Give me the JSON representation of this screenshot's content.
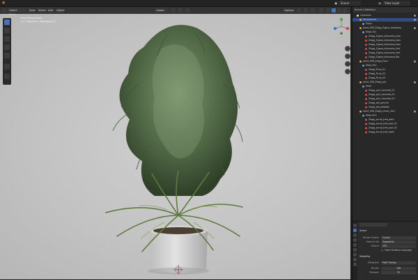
{
  "topbar": {
    "menu_icon": "blender-logo",
    "scene_label": "Scene",
    "view_layer_label": "View Layer",
    "options_label": "Options"
  },
  "viewport": {
    "mode_label": "Object Mode",
    "menus": [
      "View",
      "Select",
      "Add",
      "Object"
    ],
    "orientation_label": "Global",
    "overlay_lines": [
      "User Perspective",
      "(1) Collection | Background",
      "",
      ""
    ],
    "tools": [
      "cursor-tool",
      "move-tool",
      "rotate-tool",
      "scale-tool",
      "transform-tool",
      "annotate-tool",
      "measure-tool"
    ]
  },
  "outliner": {
    "title": "Scene Collection",
    "rows": [
      {
        "label": "Collection",
        "indent": 1,
        "type": "collection"
      },
      {
        "label": "Background",
        "indent": 2,
        "type": "object",
        "selected": true
      },
      {
        "label": "Plane",
        "indent": 3,
        "type": "mesh"
      },
      {
        "label": "plant_096_Ziagg_Zigaro_Ixilosomo",
        "indent": 2,
        "type": "object"
      },
      {
        "label": "Mesh.001",
        "indent": 3,
        "type": "mesh"
      },
      {
        "label": "Ziagg_Zigaro_Ixilosomo_leav",
        "indent": 4,
        "type": "material"
      },
      {
        "label": "Ziagg_Zigaro_Ixilosomo_leav",
        "indent": 4,
        "type": "material"
      },
      {
        "label": "Ziagg_Zigaro_Ixilosomo_leav",
        "indent": 4,
        "type": "material"
      },
      {
        "label": "Ziagg_Zigaro_Ixilosomo_leaf",
        "indent": 4,
        "type": "material"
      },
      {
        "label": "Ziagg_Zigaro_Ixilosomo_leaf",
        "indent": 4,
        "type": "material"
      },
      {
        "label": "Ziagg_Zigaro_Ixilosomo_Blo",
        "indent": 4,
        "type": "material"
      },
      {
        "label": "plant_096_Ziagg_Ficus",
        "indent": 2,
        "type": "object"
      },
      {
        "label": "Mesh.002",
        "indent": 3,
        "type": "mesh"
      },
      {
        "label": "Ziagg_Ficus_01",
        "indent": 4,
        "type": "material"
      },
      {
        "label": "Ziagg_Ficus_02",
        "indent": 4,
        "type": "material"
      },
      {
        "label": "Ziagg_Ficus_03",
        "indent": 4,
        "type": "material"
      },
      {
        "label": "plant_096_Ziagg_pot",
        "indent": 2,
        "type": "object"
      },
      {
        "label": "Mesh",
        "indent": 3,
        "type": "mesh"
      },
      {
        "label": "Ziagg_pot_Concrete_01",
        "indent": 4,
        "type": "material"
      },
      {
        "label": "Ziagg_pot_Concrete_02",
        "indent": 4,
        "type": "material"
      },
      {
        "label": "Ziagg_pot_Concrete_03",
        "indent": 4,
        "type": "material"
      },
      {
        "label": "Ziagg_pot_ground",
        "indent": 4,
        "type": "material"
      },
      {
        "label": "Ziagg_pot_pebbles",
        "indent": 4,
        "type": "material"
      },
      {
        "label": "plant_096_Ziagg_shrub_mini",
        "indent": 2,
        "type": "object"
      },
      {
        "label": "Mesh.003",
        "indent": 3,
        "type": "mesh"
      },
      {
        "label": "Ziagg_shrub_tree_bark",
        "indent": 4,
        "type": "material"
      },
      {
        "label": "Ziagg_shrub_tree_leaf_01",
        "indent": 4,
        "type": "material"
      },
      {
        "label": "Ziagg_shrub_tree_leaf_02",
        "indent": 4,
        "type": "material"
      },
      {
        "label": "Ziagg_shrub_tree_stem",
        "indent": 4,
        "type": "material"
      }
    ]
  },
  "properties": {
    "scene_title": "Scene",
    "fields": [
      {
        "label": "Render Engine",
        "value": "Cycles"
      },
      {
        "label": "Feature Set",
        "value": "Supported"
      },
      {
        "label": "Device",
        "value": "CPU"
      }
    ],
    "osl_label": "Open Shading Language",
    "sampling_title": "Sampling",
    "integrator_label": "Integrator",
    "integrator_value": "Path Tracing",
    "render_label": "Render",
    "render_value": "128",
    "viewport_label": "Viewport",
    "viewport_value": "32"
  },
  "colors": {
    "accent": "#4772b3",
    "selection": "#334d80",
    "material": "#c45454",
    "mesh": "#5fa0c8",
    "object": "#e0a040",
    "collection": "#e6e6e6"
  }
}
